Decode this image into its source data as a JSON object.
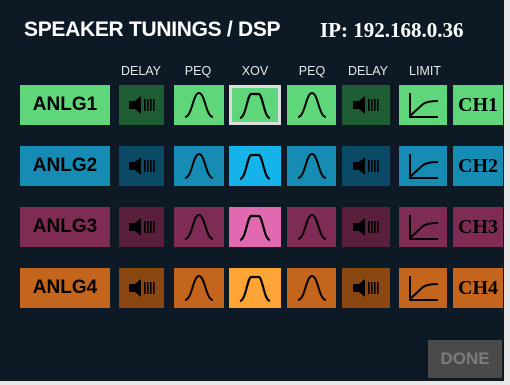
{
  "header": {
    "title": "SPEAKER TUNINGS / DSP",
    "ip": "IP: 192.168.0.36"
  },
  "columns": [
    "DELAY",
    "PEQ",
    "XOV",
    "PEQ",
    "DELAY",
    "LIMIT"
  ],
  "rows": [
    {
      "input_label": "ANLG1",
      "output_label": "CH1",
      "colors": {
        "dark": "#1f5e34",
        "light": "#5fd67a",
        "xov": "#5fd67a",
        "icon": "#000000"
      },
      "xov_selected": true
    },
    {
      "input_label": "ANLG2",
      "output_label": "CH2",
      "colors": {
        "dark": "#0b4a66",
        "light": "#168bb3",
        "xov": "#14b4ea",
        "icon": "#000000"
      },
      "xov_selected": false
    },
    {
      "input_label": "ANLG3",
      "output_label": "CH3",
      "colors": {
        "dark": "#5a1f3c",
        "light": "#7f2c55",
        "xov": "#e06aaf",
        "icon": "#000000"
      },
      "xov_selected": false
    },
    {
      "input_label": "ANLG4",
      "output_label": "CH4",
      "colors": {
        "dark": "#8a4712",
        "light": "#c3651c",
        "xov": "#ffa436",
        "icon": "#000000"
      },
      "xov_selected": false
    }
  ],
  "icons": {
    "delay": "speaker-delay-icon",
    "peq": "bell-curve-icon",
    "xov": "crossover-icon",
    "limit": "limiter-curve-icon"
  },
  "footer": {
    "done_label": "DONE"
  }
}
